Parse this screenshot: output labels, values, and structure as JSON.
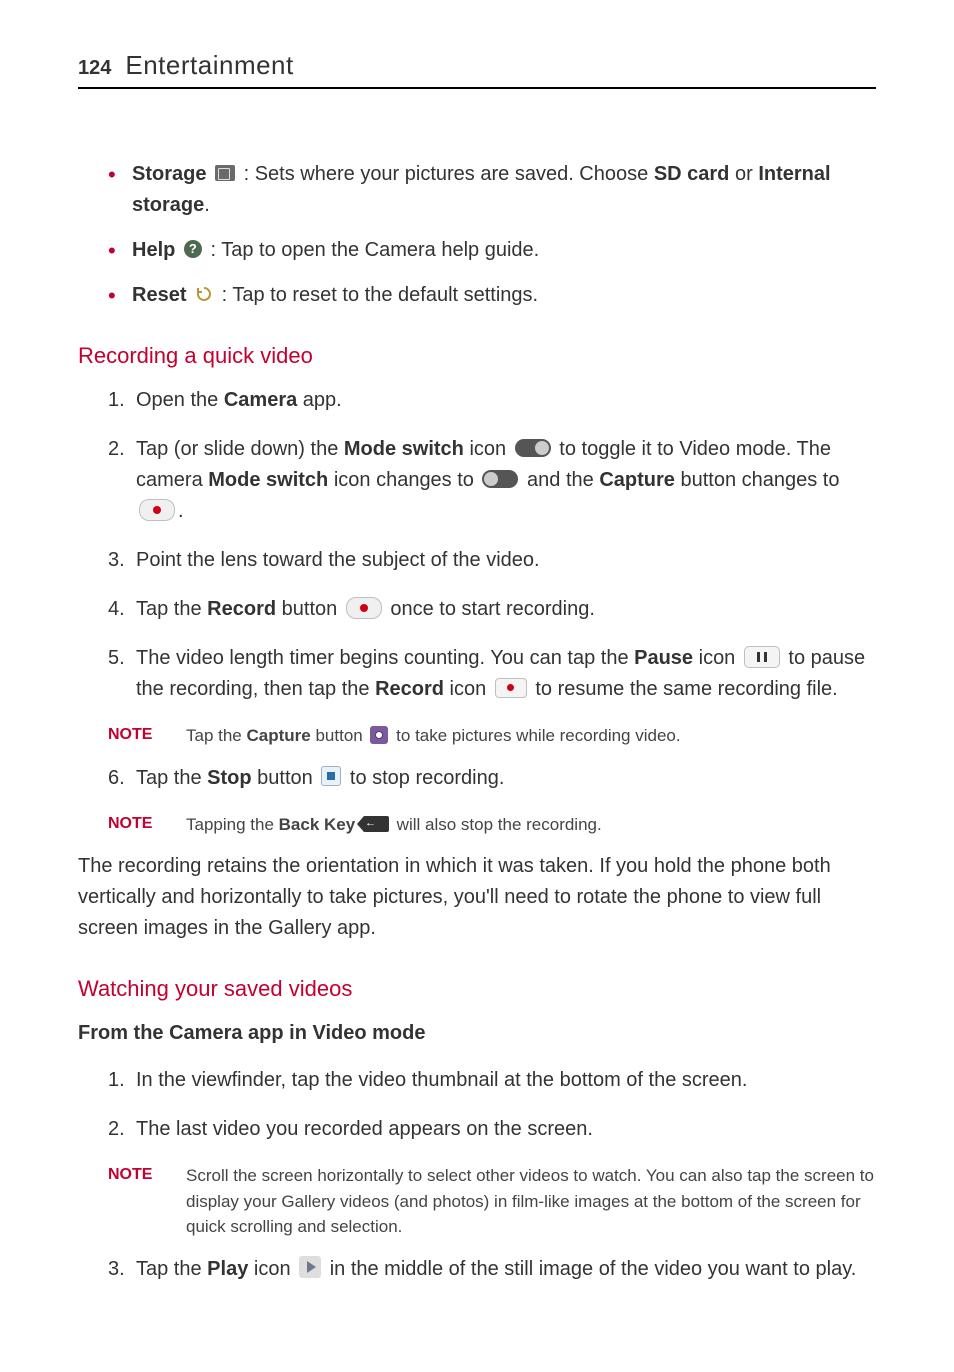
{
  "header": {
    "page_number": "124",
    "section_title": "Entertainment"
  },
  "bullets": {
    "storage": {
      "label": "Storage",
      "desc_pre": ": Sets where your pictures are saved. Choose ",
      "opt1": "SD card",
      "mid": " or ",
      "opt2": "Internal storage",
      "end": "."
    },
    "help": {
      "label": "Help",
      "desc": ": Tap to open the Camera help guide."
    },
    "reset": {
      "label": "Reset",
      "desc": ": Tap to reset to the default settings."
    }
  },
  "section1": {
    "heading": "Recording a quick video",
    "step1_pre": "Open the ",
    "step1_b": "Camera",
    "step1_post": " app.",
    "step2_pre": "Tap (or slide down) the ",
    "step2_b1": "Mode switch",
    "step2_mid1": " icon ",
    "step2_mid2": " to toggle it to Video mode. The camera ",
    "step2_b2": "Mode switch",
    "step2_mid3": " icon changes to ",
    "step2_mid4": " and the ",
    "step2_b3": "Capture",
    "step2_mid5": " button changes to ",
    "step2_end": ".",
    "step3": "Point the lens toward the subject of the video.",
    "step4_pre": "Tap the ",
    "step4_b": "Record",
    "step4_mid": " button ",
    "step4_post": " once to start recording.",
    "step5_pre": "The video length timer begins counting. You can tap the ",
    "step5_b1": "Pause",
    "step5_mid1": " icon ",
    "step5_mid2": " to pause the recording, then tap the ",
    "step5_b2": "Record",
    "step5_mid3": " icon ",
    "step5_post": " to resume the same recording file.",
    "note1_label": "NOTE",
    "note1_pre": "Tap the ",
    "note1_b": "Capture",
    "note1_mid": " button ",
    "note1_post": " to take pictures while recording video.",
    "step6_pre": "Tap the ",
    "step6_b": "Stop",
    "step6_mid": " button ",
    "step6_post": " to stop recording.",
    "note2_label": "NOTE",
    "note2_pre": "Tapping the ",
    "note2_b": "Back Key",
    "note2_post": " will also stop the recording.",
    "para": "The recording retains the orientation in which it was taken. If you hold the phone both vertically and horizontally to take pictures, you'll need to rotate the phone to view full screen images in the Gallery app."
  },
  "section2": {
    "heading": "Watching your saved videos",
    "sub": "From the Camera app in Video mode",
    "step1": "In the viewfinder, tap the video thumbnail at the bottom of the screen.",
    "step2": "The last video you recorded appears on the screen.",
    "note_label": "NOTE",
    "note_body": "Scroll the screen horizontally to select other videos to watch. You can also tap the screen to display your Gallery videos (and photos) in film-like images at the bottom of the screen for quick scrolling and selection.",
    "step3_pre": "Tap the ",
    "step3_b": "Play",
    "step3_mid": " icon ",
    "step3_post": " in the middle of the still image of the video you want to play."
  }
}
